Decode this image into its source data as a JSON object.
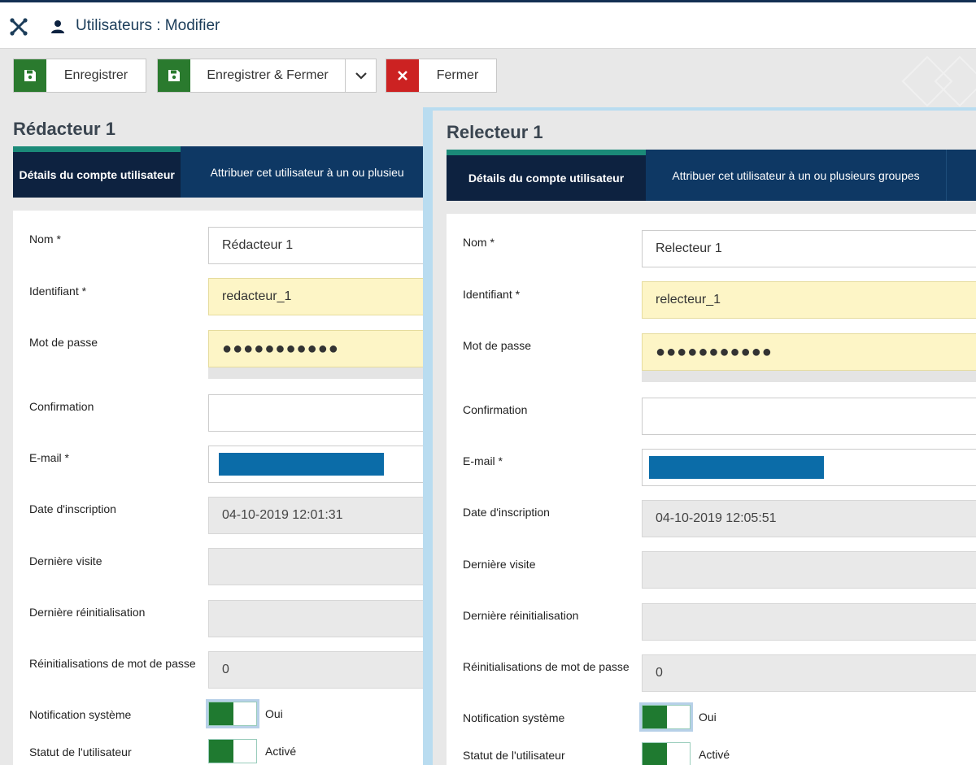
{
  "header": {
    "title": "Utilisateurs : Modifier",
    "logo_icon": "joomla-icon",
    "user_icon": "user-icon"
  },
  "toolbar": {
    "save_label": "Enregistrer",
    "save_close_label": "Enregistrer & Fermer",
    "close_label": "Fermer",
    "colors": {
      "save": "#2a7a2e",
      "close": "#cc2222"
    }
  },
  "left": {
    "name": "Rédacteur 1",
    "tabs": [
      "Détails du compte utilisateur",
      "Attribuer cet utilisateur à un ou plusieu"
    ],
    "fields": {
      "nom": "Rédacteur 1",
      "identifiant": "redacteur_1",
      "password": "●●●●●●●●●●●",
      "confirmation": "",
      "date_inscription": "04-10-2019 12:01:31",
      "derniere_visite": "",
      "derniere_reinit": "",
      "reinit_count": "0"
    }
  },
  "right": {
    "name": "Relecteur 1",
    "tabs": [
      "Détails du compte utilisateur",
      "Attribuer cet utilisateur à un ou plusieurs groupes"
    ],
    "fields": {
      "nom": "Relecteur 1",
      "identifiant": "relecteur_1",
      "password": "●●●●●●●●●●●",
      "confirmation": "",
      "date_inscription": "04-10-2019 12:05:51",
      "derniere_visite": "",
      "derniere_reinit": "",
      "reinit_count": "0"
    }
  },
  "labels": {
    "nom": "Nom *",
    "identifiant": "Identifiant *",
    "password": "Mot de passe",
    "confirmation": "Confirmation",
    "email": "E-mail *",
    "date_inscription": "Date d'inscription",
    "derniere_visite": "Dernière visite",
    "derniere_reinit": "Dernière réinitialisation",
    "reinit_count": "Réinitialisations de mot de passe",
    "notification": "Notification système",
    "statut": "Statut de l'utilisateur"
  },
  "toggles": {
    "notification_value": "Oui",
    "statut_value": "Activé"
  }
}
